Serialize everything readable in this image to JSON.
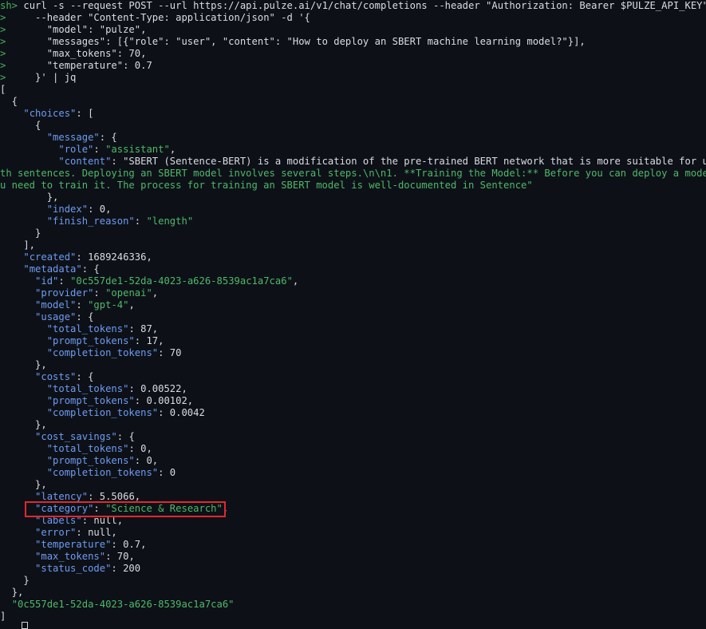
{
  "terminal": {
    "lines": [
      "sh> curl -s --request POST --url https://api.pulze.ai/v1/chat/completions --header \"Authorization: Bearer $PULZE_API_KEY\"  \\",
      ">     --header \"Content-Type: application/json\" -d '{",
      ">       \"model\": \"pulze\",",
      ">       \"messages\": [{\"role\": \"user\", \"content\": \"How to deploy an SBERT machine learning model?\"}],",
      ">       \"max_tokens\": 70,",
      ">       \"temperature\": 0.7",
      ">     }' | jq",
      "[",
      "  {",
      "    \"choices\": [",
      "      {",
      "        \"message\": {",
      "          \"role\": \"assistant\",",
      "          \"content\": \"SBERT (Sentence-BERT) is a modification of the pre-trained BERT network that is more suitable for use wi",
      "th sentences. Deploying an SBERT model involves several steps.\\n\\n1. **Training the Model:** Before you can deploy a model, yo",
      "u need to train it. The process for training an SBERT model is well-documented in Sentence\"",
      "        },",
      "        \"index\": 0,",
      "        \"finish_reason\": \"length\"",
      "      }",
      "    ],",
      "    \"created\": 1689246336,",
      "    \"metadata\": {",
      "      \"id\": \"0c557de1-52da-4023-a626-8539ac1a7ca6\",",
      "      \"provider\": \"openai\",",
      "      \"model\": \"gpt-4\",",
      "      \"usage\": {",
      "        \"total_tokens\": 87,",
      "        \"prompt_tokens\": 17,",
      "        \"completion_tokens\": 70",
      "      },",
      "      \"costs\": {",
      "        \"total_tokens\": 0.00522,",
      "        \"prompt_tokens\": 0.00102,",
      "        \"completion_tokens\": 0.0042",
      "      },",
      "      \"cost_savings\": {",
      "        \"total_tokens\": 0,",
      "        \"prompt_tokens\": 0,",
      "        \"completion_tokens\": 0",
      "      },",
      "      \"latency\": 5.5066,",
      "      \"category\": \"Science & Research\",",
      "      \"labels\": null,",
      "      \"error\": null,",
      "      \"temperature\": 0.7,",
      "      \"max_tokens\": 70,",
      "      \"status_code\": 200",
      "    }",
      "  },",
      "  \"0c557de1-52da-4023-a626-8539ac1a7ca6\"",
      "]"
    ],
    "highlighted_line_index": 42,
    "colors": {
      "background": "#0d1117",
      "prompt": "#45b15c",
      "json_key": "#6e9bf3",
      "json_string": "#4fb86a",
      "default_text": "#d9dde3",
      "highlight_border": "#e0282e"
    }
  }
}
